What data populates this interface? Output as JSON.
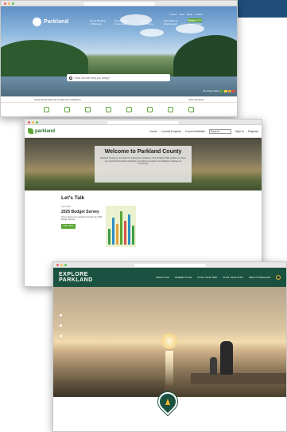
{
  "window1": {
    "logo": "Parkland",
    "nav": [
      "Home Building & Business",
      "Recreation & Community",
      "Roads & Infrastructure",
      "Agriculture & Environment",
      "County Government"
    ],
    "util": [
      "Careers",
      "News",
      "Events",
      "Contact"
    ],
    "report_btn": "Report an Issue",
    "search_placeholder": "How can we help you today?",
    "alert_left": "Latest News   Stay Up-to-Date from Parkland",
    "alert_right": "View All News",
    "weather": "Fire Danger Rating",
    "colors": {
      "accent": "#5ba535",
      "sky": "#8fb8de"
    }
  },
  "window2": {
    "logo": "parkland",
    "nav": [
      "Home",
      "Council Projects",
      "Council Website"
    ],
    "search_placeholder": "Search",
    "signin": "Sign In",
    "register": "Register",
    "hero_title": "Welcome to Parkland County",
    "hero_text": "Parkland County is committed to hearing from residents. This Parkland Talks platform is where you can find information and share your ideas on projects and initiatives shaping our community.",
    "section_title": "Let's Talk",
    "survey": {
      "date": "April 2025",
      "title": "2025 Budget Survey",
      "desc": "Tell us about your priorities through the 2025 Budget Survey.",
      "button": "Learn More"
    },
    "colors": {
      "accent": "#5ba535"
    }
  },
  "window3": {
    "logo_line1": "EXPLORE",
    "logo_line2": "PARKLAND",
    "nav": [
      "WHAT'S ON",
      "WHERE TO GO",
      "PLAN YOUR TRIP",
      "PLAN YOUR VISIT",
      "ABOUT PARKLAND"
    ],
    "colors": {
      "header": "#1b5140",
      "accent": "#f0b429"
    }
  }
}
